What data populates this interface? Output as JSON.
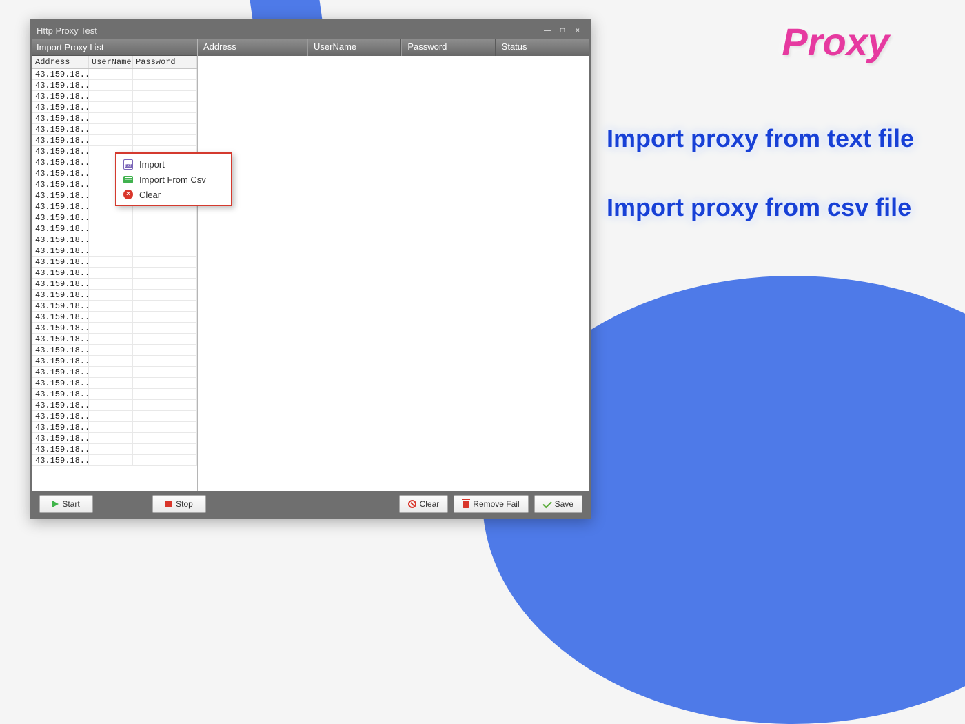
{
  "window": {
    "title": "Http Proxy  Test",
    "controls": {
      "min": "—",
      "max": "□",
      "close": "×"
    }
  },
  "leftPanel": {
    "title": "Import Proxy List",
    "columns": {
      "address": "Address",
      "username": "UserName",
      "password": "Password"
    },
    "addressValue": "43.159.18...",
    "rowCount": 36
  },
  "mainColumns": {
    "address": "Address",
    "username": "UserName",
    "password": "Password",
    "status": "Status"
  },
  "context": {
    "import": "Import",
    "importCsv": "Import From Csv",
    "clear": "Clear"
  },
  "buttons": {
    "start": "Start",
    "stop": "Stop",
    "clear": "Clear",
    "removeFail": "Remove Fail",
    "save": "Save"
  },
  "promo": {
    "title": "Proxy",
    "line1": "Import proxy from text file",
    "line2": "Import proxy from csv file"
  }
}
